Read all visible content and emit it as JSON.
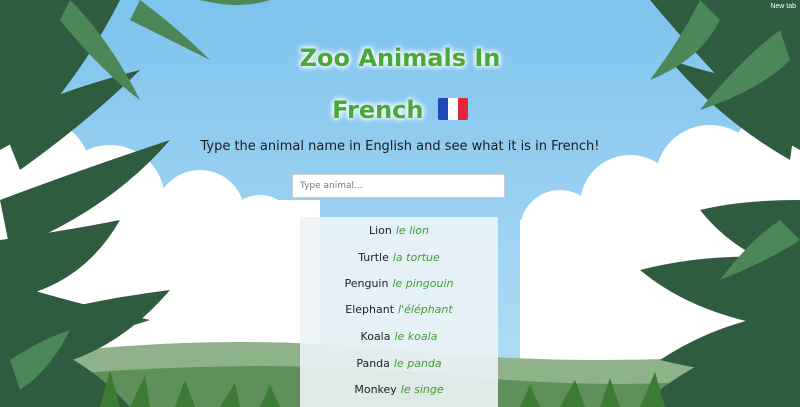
{
  "browser": {
    "new_tab_label": "New tab"
  },
  "header": {
    "title_line1": "Zoo Animals In",
    "title_line2": "French",
    "flag_icon": "france-flag-icon",
    "title_color": "#49a83a"
  },
  "subtitle": "Type the animal name in English and see what it is in French!",
  "search": {
    "placeholder": "Type animal...",
    "value": ""
  },
  "animals": [
    {
      "english": "Lion",
      "french": "le lion"
    },
    {
      "english": "Turtle",
      "french": "la tortue"
    },
    {
      "english": "Penguin",
      "french": "le pingouin"
    },
    {
      "english": "Elephant",
      "french": "l'éléphant"
    },
    {
      "english": "Koala",
      "french": "le koala"
    },
    {
      "english": "Panda",
      "french": "le panda"
    },
    {
      "english": "Monkey",
      "french": "le singe"
    }
  ],
  "colors": {
    "sky": "#8ccbee",
    "french_text": "#3e9f30",
    "leaf_dark": "#2e5a3e",
    "leaf_light": "#4f8a5a"
  }
}
